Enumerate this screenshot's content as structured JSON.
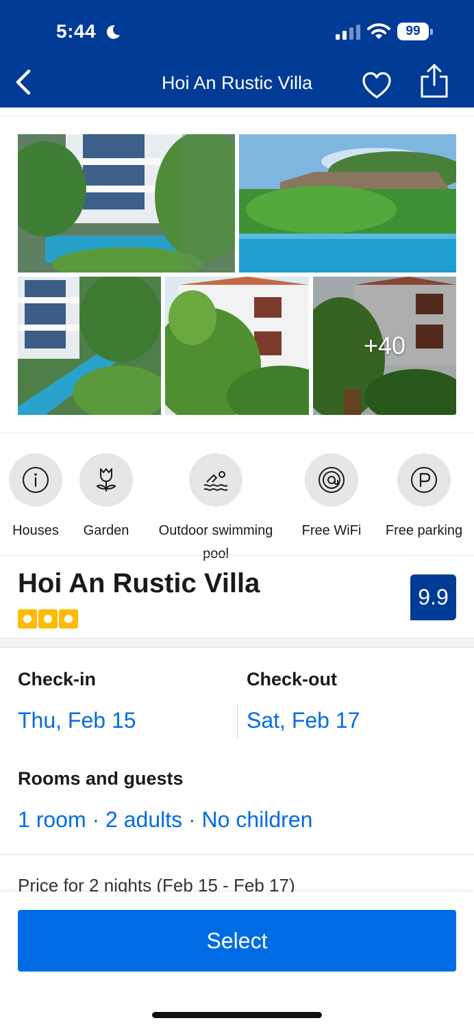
{
  "status_bar": {
    "time": "5:44",
    "battery": "99"
  },
  "header": {
    "title": "Hoi An Rustic Villa"
  },
  "gallery": {
    "more_count": "+40"
  },
  "facilities": [
    {
      "icon": "info-icon",
      "label": "Houses"
    },
    {
      "icon": "tulip-icon",
      "label": "Garden"
    },
    {
      "icon": "swimmer-icon",
      "label": "Outdoor swimming pool"
    },
    {
      "icon": "wifi-at-icon",
      "label": "Free WiFi"
    },
    {
      "icon": "parking-icon",
      "label": "Free parking"
    }
  ],
  "property": {
    "name": "Hoi An Rustic Villa",
    "rating_dots": 3,
    "score": "9.9"
  },
  "dates": {
    "checkin_label": "Check-in",
    "checkin_value": "Thu, Feb 15",
    "checkout_label": "Check-out",
    "checkout_value": "Sat, Feb 17"
  },
  "guests": {
    "label": "Rooms and guests",
    "value": "1 room · 2 adults · No children"
  },
  "price": {
    "summary": "Price for 2 nights (Feb 15 - Feb 17)"
  },
  "action": {
    "select_label": "Select"
  },
  "colors": {
    "brand_blue": "#003b95",
    "link_blue": "#006ce4",
    "star_yellow": "#febb02"
  }
}
